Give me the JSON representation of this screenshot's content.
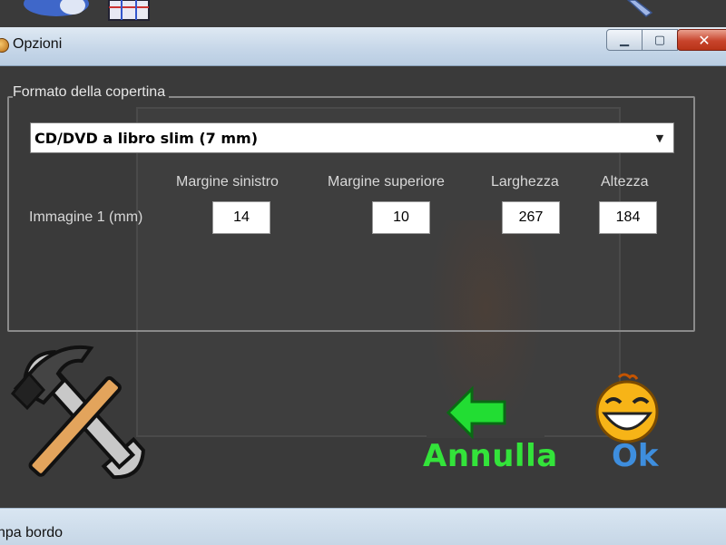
{
  "window": {
    "title": "Opzioni"
  },
  "titlebar_buttons": {
    "minimize_glyph": "▁",
    "maximize_glyph": "▢",
    "close_glyph": "✕"
  },
  "group": {
    "label": "Formato della copertina",
    "cover_format": {
      "selected": "CD/DVD a libro slim (7 mm)",
      "arrow": "▼"
    }
  },
  "margins": {
    "headers": [
      "Margine sinistro",
      "Margine superiore",
      "Larghezza",
      "Altezza"
    ],
    "row_label": "Immagine 1 (mm)",
    "values": [
      "14",
      "10",
      "267",
      "184"
    ]
  },
  "actions": {
    "cancel_label": "Annulla",
    "ok_label": "Ok"
  },
  "statusbar": {
    "text": "npa bordo"
  },
  "icons": {
    "tools": "hammer-wrench-icon",
    "cancel": "green-back-arrow-icon",
    "ok": "laughing-smiley-icon"
  },
  "colors": {
    "cancel": "#33e33a",
    "ok": "#3e8ede"
  }
}
